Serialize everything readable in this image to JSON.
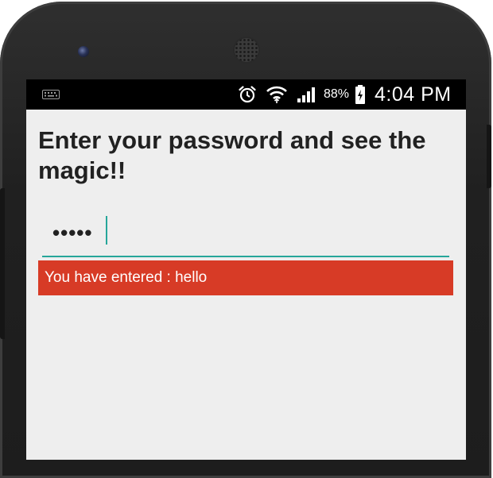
{
  "status_bar": {
    "keyboard_icon": "keyboard-icon",
    "alarm_icon": "alarm-clock-icon",
    "wifi_icon": "wifi-icon",
    "signal_icon": "cell-signal-icon",
    "battery_percent": "88%",
    "battery_icon": "battery-charging-icon",
    "time": "4:04 PM"
  },
  "app": {
    "title": "Enter your password and see the magic!!",
    "password_masked": "•••••",
    "result_text": "You have entered : hello"
  },
  "colors": {
    "accent": "#26a69a",
    "result_bg": "#d73b26",
    "screen_bg": "#eeeeee"
  }
}
